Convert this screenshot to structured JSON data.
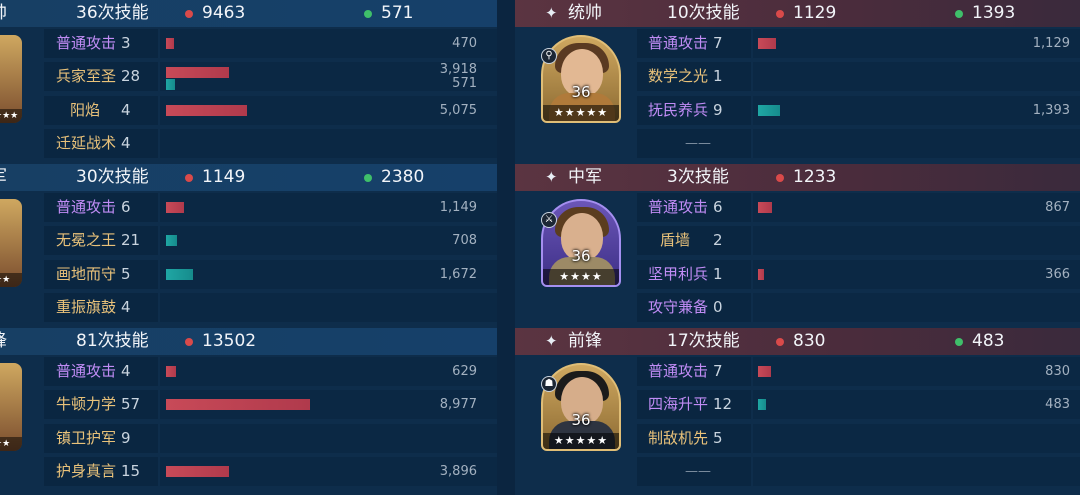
{
  "left": {
    "sections": [
      {
        "role": "帅",
        "skill_count": "36次技能",
        "damage": "9463",
        "heal": "571",
        "stars": "★★★",
        "skills": [
          {
            "name": "普通攻击",
            "count": "3",
            "dmg_value": "470",
            "heal_value": "",
            "dmg_ratio": 0.009,
            "heal_ratio": 0
          },
          {
            "name": "兵家至圣",
            "count": "28",
            "dmg_value": "3,918",
            "heal_value": "571",
            "dmg_ratio": 0.07,
            "heal_ratio": 0.01
          },
          {
            "name": "阳焰",
            "count": "4",
            "dmg_value": "5,075",
            "heal_value": "",
            "dmg_ratio": 0.09,
            "heal_ratio": 0
          },
          {
            "name": "迁延战术",
            "count": "4",
            "dmg_value": "",
            "heal_value": "",
            "dmg_ratio": 0,
            "heal_ratio": 0
          }
        ]
      },
      {
        "role": "军",
        "skill_count": "30次技能",
        "damage": "1149",
        "heal": "2380",
        "stars": "★★",
        "skills": [
          {
            "name": "普通攻击",
            "count": "6",
            "dmg_value": "1,149",
            "heal_value": "",
            "dmg_ratio": 0.02,
            "heal_ratio": 0
          },
          {
            "name": "无冕之王",
            "count": "21",
            "dmg_value": "",
            "heal_value": "708",
            "dmg_ratio": 0,
            "heal_ratio": 0.012
          },
          {
            "name": "画地而守",
            "count": "5",
            "dmg_value": "",
            "heal_value": "1,672",
            "dmg_ratio": 0,
            "heal_ratio": 0.03
          },
          {
            "name": "重振旗鼓",
            "count": "4",
            "dmg_value": "",
            "heal_value": "",
            "dmg_ratio": 0,
            "heal_ratio": 0
          }
        ]
      },
      {
        "role": "锋",
        "skill_count": "81次技能",
        "damage": "13502",
        "heal": "",
        "stars": "★★",
        "skills": [
          {
            "name": "普通攻击",
            "count": "4",
            "dmg_value": "629",
            "heal_value": "",
            "dmg_ratio": 0.011,
            "heal_ratio": 0
          },
          {
            "name": "牛顿力学",
            "count": "57",
            "dmg_value": "8,977",
            "heal_value": "",
            "dmg_ratio": 0.16,
            "heal_ratio": 0
          },
          {
            "name": "镇卫护军",
            "count": "9",
            "dmg_value": "",
            "heal_value": "",
            "dmg_ratio": 0,
            "heal_ratio": 0
          },
          {
            "name": "护身真言",
            "count": "15",
            "dmg_value": "3,896",
            "heal_value": "",
            "dmg_ratio": 0.07,
            "heal_ratio": 0
          }
        ]
      }
    ]
  },
  "right": {
    "sections": [
      {
        "role": "统帅",
        "skill_count": "10次技能",
        "damage": "1129",
        "heal": "1393",
        "level": "36",
        "stars": "★★★★★",
        "badge_icon": "⚲",
        "skills": [
          {
            "name": "普通攻击",
            "count": "7",
            "value": "1,129",
            "kind": "dmg",
            "ratio": 0.018,
            "dash": ""
          },
          {
            "name": "数学之光",
            "count": "1",
            "value": "",
            "kind": "",
            "ratio": 0,
            "dash": ""
          },
          {
            "name": "抚民养兵",
            "count": "9",
            "value": "1,393",
            "kind": "heal",
            "ratio": 0.022,
            "dash": ""
          },
          {
            "name": "",
            "count": "",
            "value": "",
            "kind": "",
            "ratio": 0,
            "dash": "——"
          }
        ]
      },
      {
        "role": "中军",
        "skill_count": "3次技能",
        "damage": "1233",
        "heal": "",
        "level": "36",
        "stars": "★★★★",
        "badge_icon": "⚔",
        "skills": [
          {
            "name": "普通攻击",
            "count": "6",
            "value": "867",
            "kind": "dmg",
            "ratio": 0.014,
            "dash": ""
          },
          {
            "name": "盾墙",
            "count": "2",
            "value": "",
            "kind": "",
            "ratio": 0,
            "dash": ""
          },
          {
            "name": "坚甲利兵",
            "count": "1",
            "value": "366",
            "kind": "dmg",
            "ratio": 0.006,
            "dash": ""
          },
          {
            "name": "攻守兼备",
            "count": "0",
            "value": "",
            "kind": "",
            "ratio": 0,
            "dash": ""
          }
        ]
      },
      {
        "role": "前锋",
        "skill_count": "17次技能",
        "damage": "830",
        "heal": "483",
        "level": "36",
        "stars": "★★★★★",
        "badge_icon": "☗",
        "skills": [
          {
            "name": "普通攻击",
            "count": "7",
            "value": "830",
            "kind": "dmg",
            "ratio": 0.013,
            "dash": ""
          },
          {
            "name": "四海升平",
            "count": "12",
            "value": "483",
            "kind": "heal",
            "ratio": 0.008,
            "dash": ""
          },
          {
            "name": "制敌机先",
            "count": "5",
            "value": "",
            "kind": "",
            "ratio": 0,
            "dash": ""
          },
          {
            "name": "",
            "count": "",
            "value": "",
            "kind": "",
            "ratio": 0,
            "dash": "——"
          }
        ]
      }
    ]
  },
  "colors": {
    "background": "#0e2d4b",
    "header_blue": "#173f64",
    "header_red": "#5b3441",
    "damage": "#c84a58",
    "heal": "#1fa7a4",
    "skill_purple": "#c08cf5",
    "skill_gold": "#e9c27a"
  }
}
